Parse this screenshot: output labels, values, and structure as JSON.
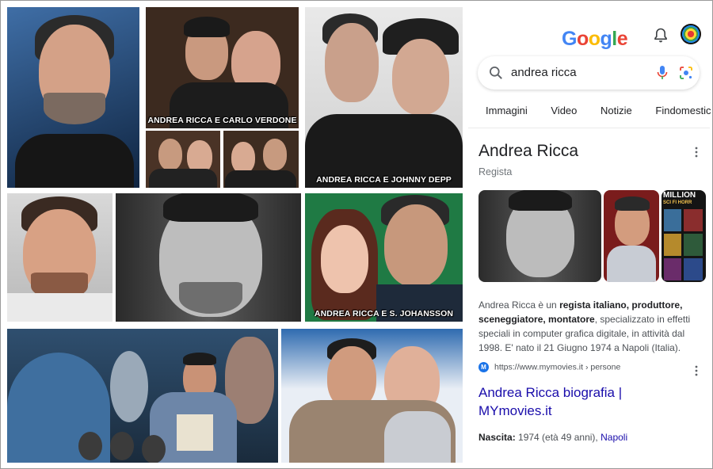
{
  "collage": {
    "captions": {
      "verdone": "ANDREA RICCA E CARLO VERDONE",
      "depp": "ANDREA RICCA E JOHNNY DEPP",
      "johansson": "ANDREA RICCA E S. JOHANSSON"
    }
  },
  "panel": {
    "logo_letters": [
      {
        "ch": "G",
        "color": "#4285F4"
      },
      {
        "ch": "o",
        "color": "#EA4335"
      },
      {
        "ch": "o",
        "color": "#FBBC05"
      },
      {
        "ch": "g",
        "color": "#4285F4"
      },
      {
        "ch": "l",
        "color": "#34A853"
      },
      {
        "ch": "e",
        "color": "#EA4335"
      }
    ],
    "icons": {
      "bell": "bell-icon",
      "avatar": "avatar",
      "search": "search-icon",
      "mic": "mic-icon",
      "lens": "lens-icon",
      "more": "more-vert-icon"
    },
    "search": {
      "query": "andrea ricca"
    },
    "tabs": [
      "Immagini",
      "Video",
      "Notizie",
      "Findomestic"
    ],
    "entity": {
      "title": "Andrea Ricca",
      "subtitle": "Regista"
    },
    "description": {
      "part1": "Andrea Ricca è un ",
      "bold": "regista italiano, produttore, sceneggiatore, montatore",
      "part2": ", specializzato in effetti speciali in computer grafica digitale, in attività dal 1998. E' nato il 21 Giugno 1974 a Napoli (Italia)."
    },
    "source": {
      "favicon": "M",
      "url": "https://www.mymovies.it › persone"
    },
    "link": "Andrea Ricca biografia | MYmovies.it",
    "born": {
      "label": "Nascita:",
      "value": " 1974 (età 49 anni), ",
      "place": "Napoli"
    },
    "thumb_poster": {
      "title": "MILLION",
      "subtitle": "SCI FI HORR"
    },
    "colors": {
      "link": "#1a0dab",
      "text": "#202124",
      "muted": "#70757a",
      "accent": "#1a73e8"
    }
  }
}
